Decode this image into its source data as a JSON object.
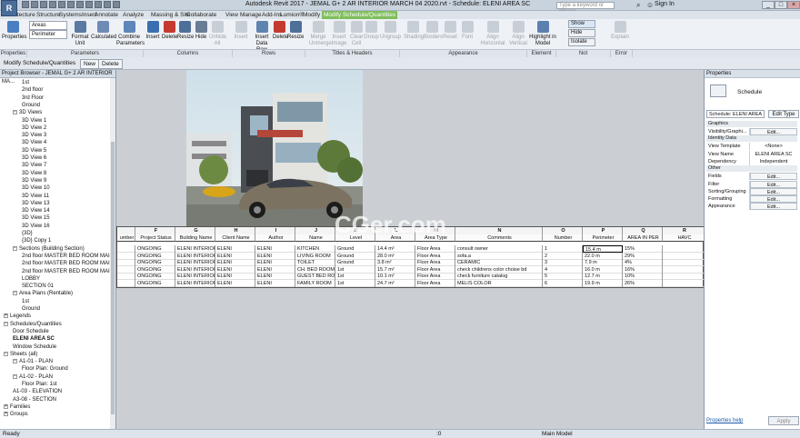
{
  "app": {
    "logo": "R",
    "title": "Autodesk Revit 2017 -  JEMAL G+ 2 AR INTERIOR MARCH 04 2020.rvt - Schedule: ELENI AREA SC",
    "search_placeholder": "Type a keyword or phrase",
    "sign_in": "Sign In"
  },
  "tabs": [
    "Architecture",
    "Structure",
    "Systems",
    "Insert",
    "Annotate",
    "Analyze",
    "Massing & Site",
    "Collaborate",
    "View",
    "Manage",
    "Add-Ins",
    "Lumion®",
    "Modify",
    "Modify Schedule/Quantities"
  ],
  "ribbon": {
    "buttons": [
      {
        "label": "Properties",
        "color": "#4a7fc1"
      },
      {
        "label": "Areas",
        "color": "#fff"
      },
      {
        "label": "Perimeter",
        "color": "#fff"
      },
      {
        "label": "Format Unit",
        "color": "#5a7aa3"
      },
      {
        "label": "Calculated",
        "color": "#6e8bb5"
      },
      {
        "label": "Combine Parameters",
        "color": "#5d86ba"
      },
      {
        "label": "Insert",
        "color": "#3c6fb0"
      },
      {
        "label": "Delete",
        "color": "#c43a2f"
      },
      {
        "label": "Resize",
        "color": "#4e6f9a"
      },
      {
        "label": "Hide",
        "color": "#6a7d96"
      },
      {
        "label": "Unhide All",
        "color": "#b0b0b0"
      },
      {
        "label": "Insert",
        "color": "#b0b0b0"
      },
      {
        "label": "Insert Data Row",
        "color": "#5f83b1"
      },
      {
        "label": "Delete",
        "color": "#c43a2f"
      },
      {
        "label": "Resize",
        "color": "#4e6f9a"
      },
      {
        "label": "Merge Unmerge",
        "color": "#b0b0b0"
      },
      {
        "label": "Insert Image",
        "color": "#b0b0b0"
      },
      {
        "label": "Clear Cell",
        "color": "#b0b0b0"
      },
      {
        "label": "Group",
        "color": "#b0b0b0"
      },
      {
        "label": "Ungroup",
        "color": "#b0b0b0"
      },
      {
        "label": "Shading",
        "color": "#b0b0b0"
      },
      {
        "label": "Borders",
        "color": "#b0b0b0"
      },
      {
        "label": "Reset",
        "color": "#b0b0b0"
      },
      {
        "label": "Font",
        "color": "#b0b0b0"
      },
      {
        "label": "Align Horizontal",
        "color": "#b0b0b0"
      },
      {
        "label": "Align Vertical",
        "color": "#b0b0b0"
      },
      {
        "label": "Highlight in Model",
        "color": "#5b7fae"
      },
      {
        "label": "Show",
        "color": "#4a7fc1"
      },
      {
        "label": "Hide",
        "color": "#b0b0b0"
      },
      {
        "label": "Isolate",
        "color": "#b0b0b0"
      },
      {
        "label": "Explain",
        "color": "#b0b0b0"
      }
    ],
    "groups": [
      "Properties",
      "Parameters",
      "Columns",
      "Rows",
      "Titles & Headers",
      "Appearance",
      "Element",
      "Not Placed/Unenclosed",
      "Error"
    ]
  },
  "options_bar": {
    "context": "Modify Schedule/Quantities",
    "new_label": "New",
    "delete_label": "Delete"
  },
  "browser": {
    "title": "Project Browser - JEMAL G+ 2 AR INTERIOR MA...",
    "items": [
      {
        "label": "1st",
        "indent": 2
      },
      {
        "label": "2nd floor",
        "indent": 2
      },
      {
        "label": "3rd Floor",
        "indent": 2
      },
      {
        "label": "Ground",
        "indent": 2
      },
      {
        "label": "3D Views",
        "indent": 1,
        "box": "−"
      },
      {
        "label": "3D View 1",
        "indent": 2
      },
      {
        "label": "3D View 2",
        "indent": 2
      },
      {
        "label": "3D View 3",
        "indent": 2
      },
      {
        "label": "3D View 4",
        "indent": 2
      },
      {
        "label": "3D View 5",
        "indent": 2
      },
      {
        "label": "3D View 6",
        "indent": 2
      },
      {
        "label": "3D View 7",
        "indent": 2
      },
      {
        "label": "3D View 8",
        "indent": 2
      },
      {
        "label": "3D View 9",
        "indent": 2
      },
      {
        "label": "3D View 10",
        "indent": 2
      },
      {
        "label": "3D View 11",
        "indent": 2
      },
      {
        "label": "3D View 13",
        "indent": 2
      },
      {
        "label": "3D View 14",
        "indent": 2
      },
      {
        "label": "3D View 15",
        "indent": 2
      },
      {
        "label": "3D View 16",
        "indent": 2
      },
      {
        "label": "{3D}",
        "indent": 2
      },
      {
        "label": "{3D} Copy 1",
        "indent": 2
      },
      {
        "label": "Sections (Building Section)",
        "indent": 1,
        "box": "−"
      },
      {
        "label": "2nd floor MASTER BED ROOM MAIN",
        "indent": 2
      },
      {
        "label": "2nd floor MASTER BED ROOM MAIN",
        "indent": 2
      },
      {
        "label": "2nd floor MASTER BED ROOM MAIN",
        "indent": 2
      },
      {
        "label": "LOBBY",
        "indent": 2
      },
      {
        "label": "SECTION 01",
        "indent": 2
      },
      {
        "label": "Area Plans (Rentable)",
        "indent": 1,
        "box": "−"
      },
      {
        "label": "1st",
        "indent": 2
      },
      {
        "label": "Ground",
        "indent": 2
      },
      {
        "label": "Legends",
        "indent": 0,
        "box": "+"
      },
      {
        "label": "Schedules/Quantities",
        "indent": 0,
        "box": "−"
      },
      {
        "label": "Door Schedule",
        "indent": 1
      },
      {
        "label": "ELENI AREA SC",
        "indent": 1,
        "bold": true
      },
      {
        "label": "Window Schedule",
        "indent": 1
      },
      {
        "label": "Sheets (all)",
        "indent": 0,
        "box": "−"
      },
      {
        "label": "A1-01 - PLAN",
        "indent": 1,
        "box": "−"
      },
      {
        "label": "Floor Plan: Ground",
        "indent": 2
      },
      {
        "label": "A1-02 - PLAN",
        "indent": 1,
        "box": "−"
      },
      {
        "label": "Floor Plan: 1st",
        "indent": 2
      },
      {
        "label": "A1-03 - ELEVATION",
        "indent": 1
      },
      {
        "label": "A3-08 - SECTION",
        "indent": 1
      },
      {
        "label": "Families",
        "indent": 0,
        "box": "+"
      },
      {
        "label": "Groups",
        "indent": 0,
        "box": "+"
      }
    ]
  },
  "schedule": {
    "letters": [
      "",
      "F",
      "G",
      "H",
      "I",
      "J",
      "K",
      "L",
      "M",
      "N",
      "O",
      "P",
      "Q",
      "R"
    ],
    "columns": [
      "umber",
      "Project Status",
      "Building Name",
      "Client Name",
      "Author",
      "Name",
      "Level",
      "Area",
      "Area Type",
      "Comments",
      "Number",
      "Perimeter",
      "AREA IN PER",
      "HAVC"
    ],
    "rows": [
      [
        "",
        "ONGOING",
        "ELENI INTERIOR",
        "ELENI",
        "ELENI",
        "KITCHEN",
        "Ground",
        "14.4 m²",
        "Floor Area",
        "consult owner",
        "1",
        "15.4 m",
        "15%",
        ""
      ],
      [
        "",
        "ONGOING",
        "ELENI INTERIOR",
        "ELENI",
        "ELENI",
        "LIVING ROOM",
        "Ground",
        "28.0 m²",
        "Floor Area",
        "sofa.a",
        "2",
        "22.0 m",
        "29%",
        ""
      ],
      [
        "",
        "ONGOING",
        "ELENI INTERIOR",
        "ELENI",
        "ELENI",
        "TOILET",
        "Ground",
        "3.8 m²",
        "Floor Area",
        "CERAMIC",
        "3",
        "7.9 m",
        "4%",
        ""
      ],
      [
        "",
        "ONGOING",
        "ELENI INTERIOR",
        "ELENI",
        "ELENI",
        "CH. BED ROOM",
        "1st",
        "15.7 m²",
        "Floor Area",
        "check childrens color choise bd",
        "4",
        "16.0 m",
        "16%",
        ""
      ],
      [
        "",
        "ONGOING",
        "ELENI INTERIOR",
        "ELENI",
        "ELENI",
        "GUEST BED ROOM",
        "1st",
        "10.1 m²",
        "Floor Area",
        "check furniture catalog",
        "5",
        "12.7 m",
        "10%",
        ""
      ],
      [
        "",
        "ONGOING",
        "ELENI INTERIOR",
        "ELENI",
        "ELENI",
        "FAMILY ROOM",
        "1st",
        "24.7 m²",
        "Floor Area",
        "MELIS COLOR",
        "6",
        "19.9 m",
        "26%",
        ""
      ]
    ]
  },
  "properties": {
    "title": "Properties",
    "type": "Schedule",
    "selector": "Schedule: ELENI AREA",
    "edit_type": "Edit Type",
    "groups": [
      {
        "name": "Graphics",
        "rows": [
          [
            "Visibility/Graphi...",
            "Edit..."
          ]
        ]
      },
      {
        "name": "Identity Data",
        "rows": [
          [
            "View Template",
            "<None>"
          ],
          [
            "View Name",
            "ELENI AREA SC"
          ],
          [
            "Dependency",
            "Independent"
          ]
        ]
      },
      {
        "name": "Other",
        "rows": [
          [
            "Fields",
            "Edit..."
          ],
          [
            "Filter",
            "Edit..."
          ],
          [
            "Sorting/Grouping",
            "Edit..."
          ],
          [
            "Formatting",
            "Edit..."
          ],
          [
            "Appearance",
            "Edit..."
          ]
        ]
      }
    ],
    "help": "Properties help",
    "apply": "Apply"
  },
  "status": {
    "text": "Ready",
    "zoom": ":0",
    "model": "Main Model"
  },
  "watermark": "CGer.com"
}
